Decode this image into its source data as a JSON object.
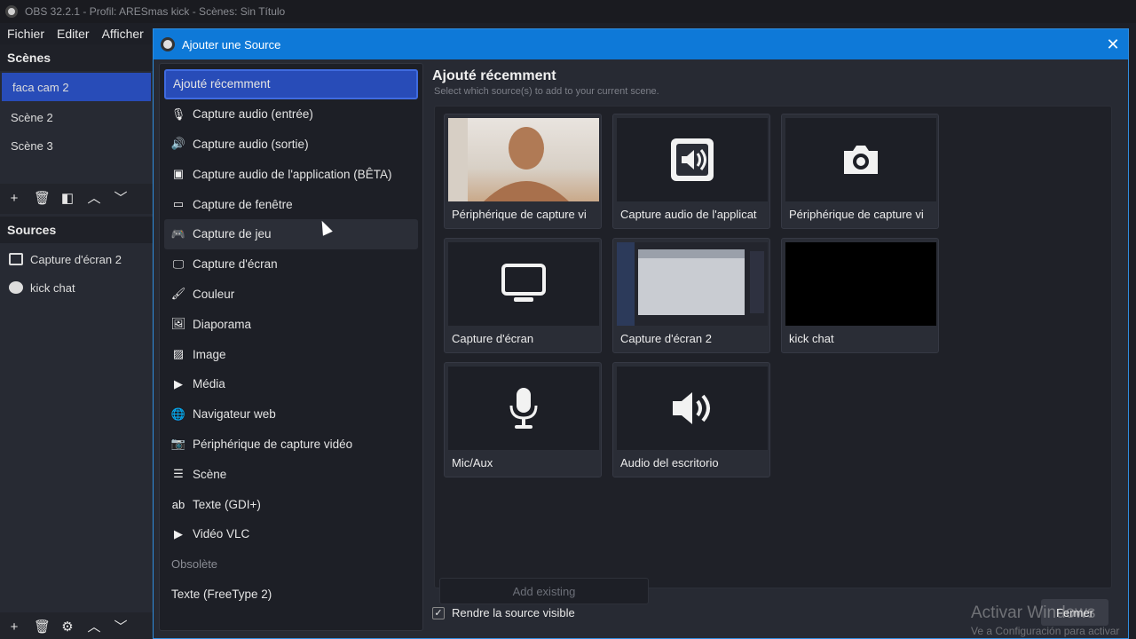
{
  "window": {
    "title": "OBS 32.2.1 - Profil: ARESmas kick - Scènes: Sin Título"
  },
  "menu": [
    "Fichier",
    "Editer",
    "Afficher"
  ],
  "scenes_dock": {
    "header": "Scènes",
    "items": [
      {
        "label": "faca cam 2",
        "active": true
      },
      {
        "label": "Scène 2",
        "active": false
      },
      {
        "label": "Scène 3",
        "active": false
      }
    ]
  },
  "sources_dock": {
    "header": "Sources",
    "items": [
      {
        "label": "Capture d'écran 2",
        "icon": "monitor-icon"
      },
      {
        "label": "kick chat",
        "icon": "globe-icon"
      }
    ]
  },
  "dialog": {
    "title": "Ajouter une Source",
    "list": [
      {
        "label": "Ajouté récemment",
        "icon": "",
        "state": "selected"
      },
      {
        "label": "Capture audio (entrée)",
        "icon": "mic-icon"
      },
      {
        "label": "Capture audio (sortie)",
        "icon": "speaker-icon"
      },
      {
        "label": "Capture audio de l'application (BÊTA)",
        "icon": "app-audio-icon"
      },
      {
        "label": "Capture de fenêtre",
        "icon": "window-icon"
      },
      {
        "label": "Capture de jeu",
        "icon": "gamepad-icon",
        "state": "hover"
      },
      {
        "label": "Capture d'écran",
        "icon": "monitor-icon"
      },
      {
        "label": "Couleur",
        "icon": "brush-icon"
      },
      {
        "label": "Diaporama",
        "icon": "slideshow-icon"
      },
      {
        "label": "Image",
        "icon": "image-icon"
      },
      {
        "label": "Média",
        "icon": "play-icon"
      },
      {
        "label": "Navigateur web",
        "icon": "globe-icon"
      },
      {
        "label": "Périphérique de capture vidéo",
        "icon": "camera-icon"
      },
      {
        "label": "Scène",
        "icon": "list-icon"
      },
      {
        "label": "Texte (GDI+)",
        "icon": "text-icon"
      },
      {
        "label": "Vidéo VLC",
        "icon": "play-icon"
      },
      {
        "label": "Obsolète",
        "icon": "",
        "state": "section"
      },
      {
        "label": "Texte (FreeType 2)",
        "icon": ""
      }
    ],
    "right_title": "Ajouté récemment",
    "right_subtitle": "Select which source(s) to add to your current scene.",
    "cards": [
      {
        "label": "Périphérique de capture vi",
        "thumb": "webcam-preview"
      },
      {
        "label": "Capture audio de l'applicat",
        "thumb": "app-audio-icon"
      },
      {
        "label": "Périphérique de capture vi",
        "thumb": "camera-icon"
      },
      {
        "label": "Capture d'écran",
        "thumb": "monitor-icon"
      },
      {
        "label": "Capture d'écran 2",
        "thumb": "screen-preview"
      },
      {
        "label": "kick chat",
        "thumb": "black-preview"
      },
      {
        "label": "Mic/Aux",
        "thumb": "mic-icon"
      },
      {
        "label": "Audio del escritorio",
        "thumb": "speaker-icon"
      }
    ],
    "add_existing": "Add existing",
    "visible_label": "Rendre la source visible",
    "visible_checked": true,
    "close_label": "Fermer"
  },
  "watermark": {
    "title": "Activar Windows",
    "subtitle": "Ve a Configuración para activar Windows."
  }
}
